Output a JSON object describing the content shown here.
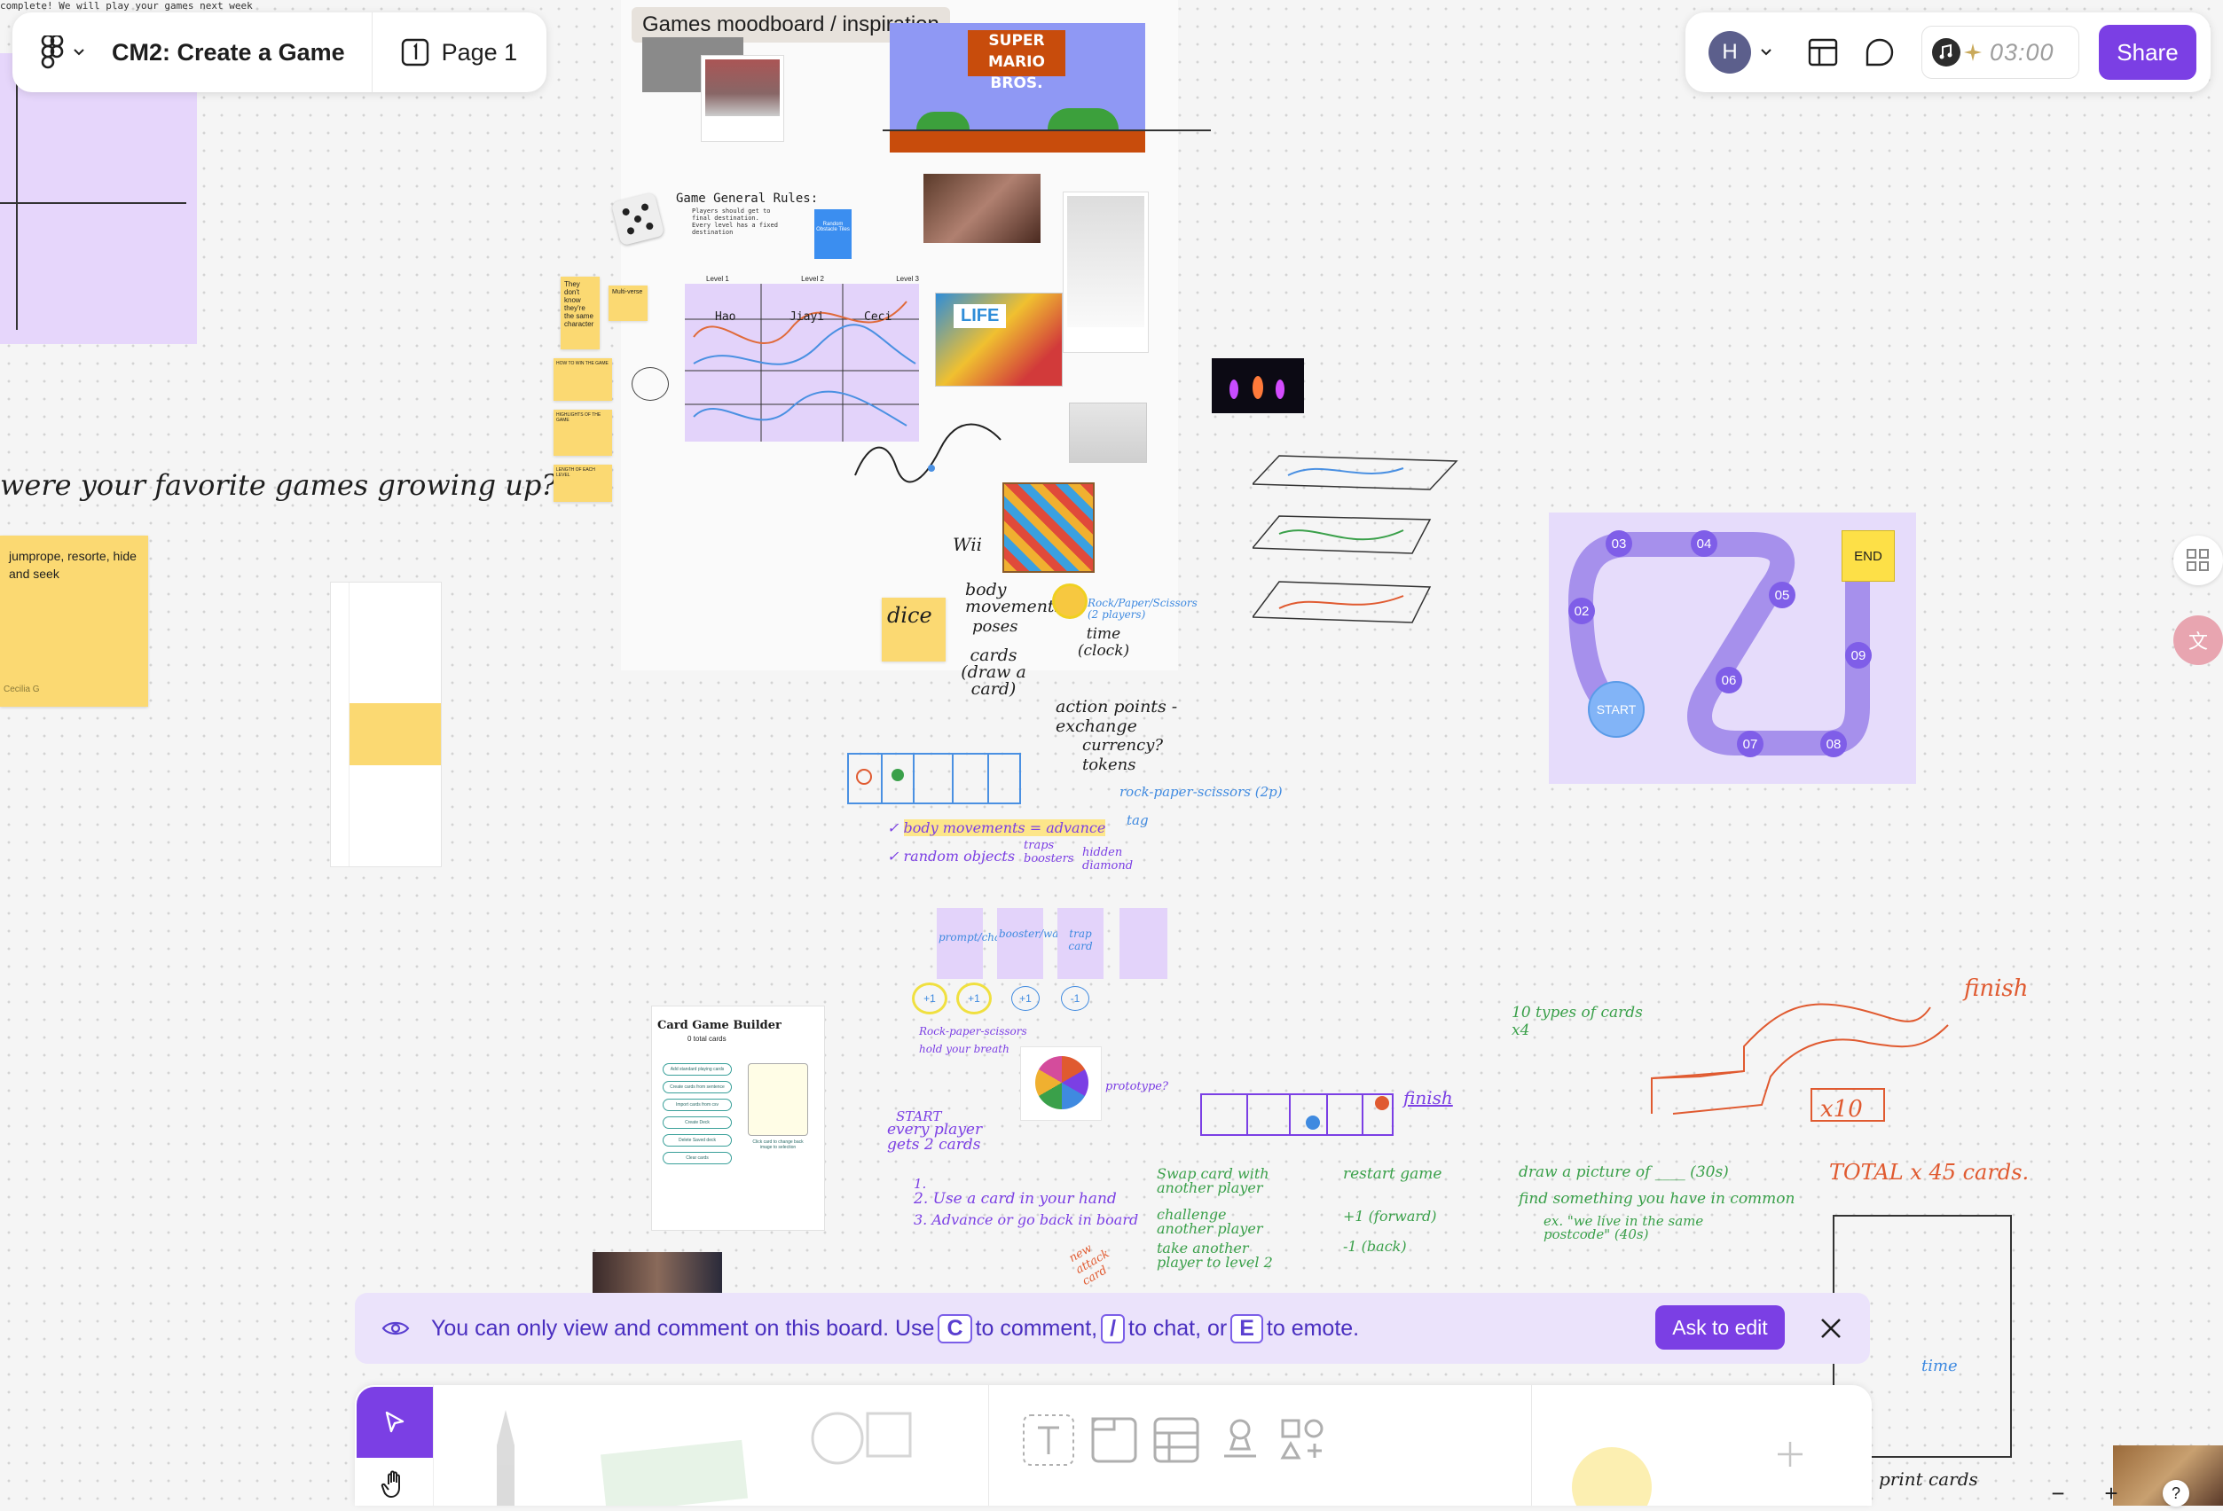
{
  "top_ticker": "complete! We will play your games next week",
  "left_panel": {
    "file_title": "CM2: Create a Game",
    "page_label": "Page 1"
  },
  "right_panel": {
    "avatar_initial": "H",
    "timer": "03:00",
    "share_label": "Share"
  },
  "canvas": {
    "moodboard_title": "Games moodboard / inspiration",
    "favorite_prompt": "were your favorite games growing up?",
    "sticky_favorites": "jumprope, resorte, hide and seek",
    "sticky_author": "Cecilia G",
    "rules_title": "Game General Rules:",
    "rules_item_1": "Players should get to final destination. Every level has a fixed destination",
    "blue_card_text": "Random Obstacle Tiles",
    "level_labels": [
      "Level 1",
      "Level 2",
      "Level 3"
    ],
    "player_names": [
      "Hao",
      "Jiayi",
      "Ceci"
    ],
    "yellow_notes": [
      "They don't know they're the same character",
      "Multi-verse"
    ],
    "small_notes": [
      "HOW TO WIN THE GAME",
      "HIGHLIGHTS OF THE GAME",
      "LENGTH OF EACH LEVEL"
    ],
    "game_board": {
      "start_label": "START",
      "end_label": "END",
      "nodes": [
        "02",
        "03",
        "04",
        "05",
        "06",
        "07",
        "08",
        "09"
      ]
    },
    "card_builder": {
      "title": "Card Game Builder",
      "subtitle": "0 total cards",
      "buttons": [
        "Add standard playing cards",
        "Create cards from sentence",
        "Import cards from csv",
        "Create Deck",
        "Delete Saved deck",
        "Clear cards"
      ],
      "hint": "Click card to change back image to selection"
    },
    "annotations": {
      "wii": "Wii",
      "body_movements": "body movements",
      "poses": "poses",
      "cards_draw": "cards (draw a card)",
      "dice": "dice",
      "rps": "Rock/Paper/Scissors (2 players)",
      "time_clock": "time (clock)",
      "action_points": "action points - exchange",
      "currency": "currency?",
      "tokens": "tokens",
      "rps_2p": "rock-paper-scissors (2p)",
      "tag": "tag",
      "body_movements_advance": "body movements = advance",
      "random_objects": "random objects",
      "traps_boosters": "traps boosters",
      "hidden_diamond": "hidden diamond",
      "card_prompt": "prompt/challenge",
      "card_booster": "booster/walk",
      "card_trap": "trap card",
      "plus1": "+1",
      "minus1": "-1",
      "rock_paper": "Rock-paper-scissors",
      "hold_breath": "hold your breath",
      "prototype": "prototype?",
      "start_note": "START",
      "every_player": "every player gets 2 cards",
      "step_1": "1.",
      "step_2": "2. Use a card in your hand",
      "step_3": "3. Advance or go back in board",
      "swap_card": "Swap card with another player",
      "challenge": "challenge another player",
      "take_another": "take another player to level 2",
      "restart": "restart game",
      "forward": "+1 (forward)",
      "back": "-1 (back)",
      "draw_picture": "draw a picture of ____ (30s)",
      "find_common": "find something you have in common",
      "live_postcode": "ex. \"we live in the same postcode\" (40s)",
      "ten_types": "10 types of cards x4",
      "finish": "finish",
      "finish2": "finish",
      "x10": "x10",
      "total": "TOTAL x 45 cards.",
      "time_label": "time",
      "print_cards": "print cards",
      "new_attack_card": "new attack card"
    }
  },
  "banner": {
    "text_before": "You can only view and comment on this board. Use",
    "key_comment": "C",
    "text_comment": "to comment,",
    "key_chat": "/",
    "text_chat": "to chat, or",
    "key_emote": "E",
    "text_emote": "to emote.",
    "ask_label": "Ask to edit"
  },
  "toolbar": {
    "tools": [
      "move",
      "hand",
      "pen",
      "shape",
      "text",
      "section",
      "table",
      "stamp",
      "more"
    ]
  },
  "zoom": {
    "minus": "−",
    "plus": "+",
    "help": "?"
  },
  "colors": {
    "accent": "#7b3fe4",
    "banner_bg": "#ebe3fb",
    "sticky": "#fbd972",
    "board_bg": "#e6dcfb",
    "track": "#a690ec"
  }
}
